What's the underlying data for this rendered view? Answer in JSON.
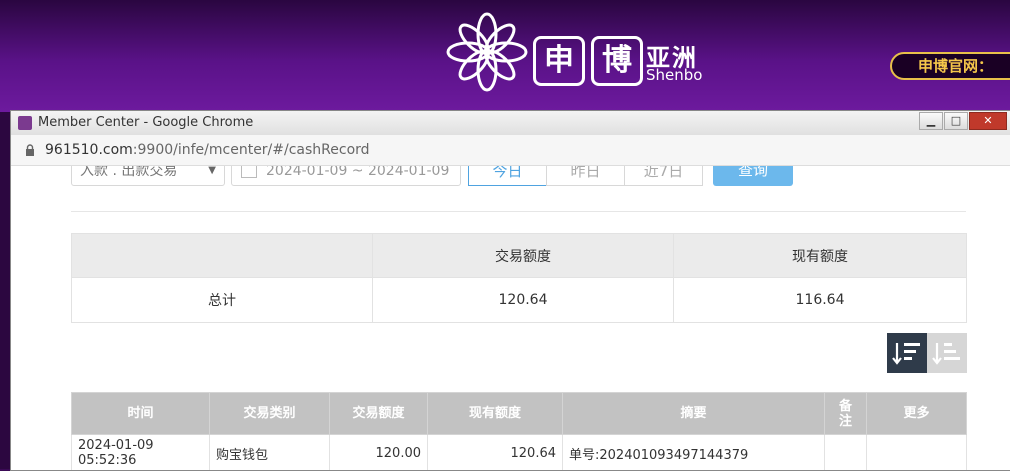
{
  "banner": {
    "brand_box_1": "申",
    "brand_box_2": "博",
    "brand_asia": "亚洲",
    "brand_en": "Shenbo",
    "site_label": "申博官网："
  },
  "window": {
    "title": "Member Center - Google Chrome",
    "url_host": "961510.com",
    "url_path": ":9900/infe/mcenter/#/cashRecord",
    "minimize_label": "▁",
    "maximize_label": "□",
    "close_label": "✕"
  },
  "filters": {
    "type_select": "入款 . 出款交易",
    "date_range": "2024-01-09 ~ 2024-01-09",
    "quick_today": "今日",
    "quick_yesterday": "昨日",
    "quick_last7": "近7日",
    "query_button": "查询"
  },
  "summary": {
    "headers": [
      "",
      "交易额度",
      "现有额度"
    ],
    "row": {
      "label": "总计",
      "amount": "120.64",
      "balance": "116.64"
    }
  },
  "records": {
    "headers": [
      "时间",
      "交易类别",
      "交易额度",
      "现有额度",
      "摘要",
      "备注",
      "更多"
    ],
    "rows": [
      [
        "2024-01-09 05:52:36",
        "购宝钱包",
        "120.00",
        "120.64",
        "单号:202401093497144379",
        "",
        ""
      ]
    ]
  },
  "colors": {
    "banner_purple": "#5a1288",
    "active_blue": "#4fa3e0",
    "query_blue": "#6cb8ec",
    "header_gray": "#c2c2c2"
  },
  "icons": [
    "flower-logo-icon",
    "lock-icon",
    "calendar-icon",
    "sort-desc-icon",
    "sort-asc-icon",
    "chevron-down-icon"
  ]
}
